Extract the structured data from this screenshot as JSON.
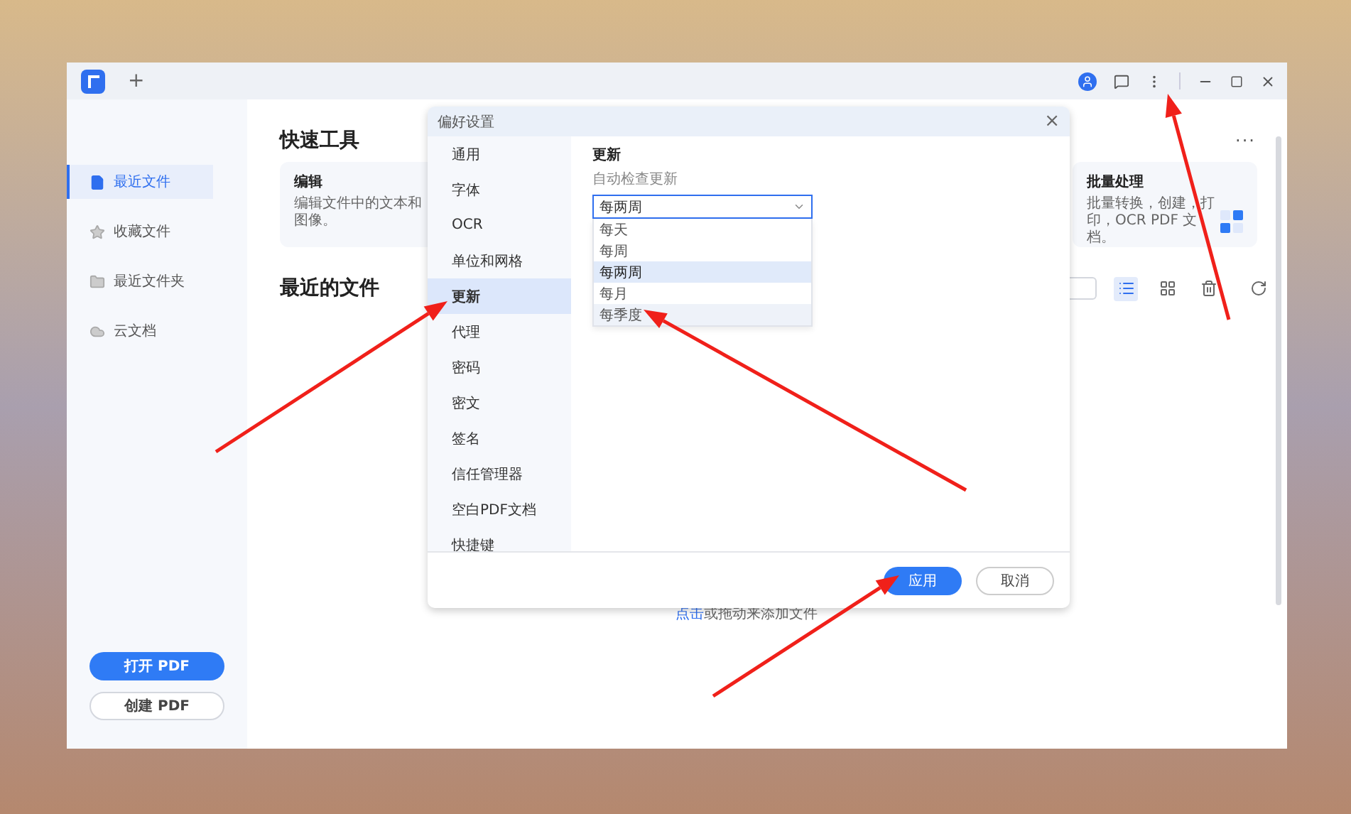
{
  "titlebar": {
    "new_tab": "+"
  },
  "sidebar": {
    "items": [
      {
        "label": "最近文件",
        "selected": true
      },
      {
        "label": "收藏文件",
        "selected": false
      },
      {
        "label": "最近文件夹",
        "selected": false
      },
      {
        "label": "云文档",
        "selected": false
      }
    ],
    "buttons": [
      {
        "label": "打开 PDF",
        "kind": "primary"
      },
      {
        "label": "创建 PDF",
        "kind": "secondary"
      }
    ]
  },
  "quick_tools": {
    "title": "快速工具",
    "more": "···",
    "cards": [
      {
        "title": "编辑",
        "description": "编辑文件中的文本和图像。"
      },
      {
        "title": "批量处理",
        "description": "批量转换，创建，打印，OCR PDF 文档。"
      }
    ]
  },
  "recent_files": {
    "title": "最近的文件",
    "views": [
      {
        "selected": true
      },
      {
        "selected": false
      }
    ],
    "drop_hint_link": "点击",
    "drop_hint": "或拖动来添加文件"
  },
  "dialog": {
    "title": "偏好设置",
    "close": "×",
    "nav": [
      {
        "label": "通用",
        "selected": false
      },
      {
        "label": "字体",
        "selected": false
      },
      {
        "label": "OCR",
        "selected": false
      },
      {
        "label": "单位和网格",
        "selected": false
      },
      {
        "label": "更新",
        "selected": true
      },
      {
        "label": "代理",
        "selected": false
      },
      {
        "label": "密码",
        "selected": false
      },
      {
        "label": "密文",
        "selected": false
      },
      {
        "label": "签名",
        "selected": false
      },
      {
        "label": "信任管理器",
        "selected": false
      },
      {
        "label": "空白PDF文档",
        "selected": false
      },
      {
        "label": "快捷键",
        "selected": false
      }
    ],
    "section_title": "更新",
    "field_label": "自动检查更新",
    "select": {
      "value": "每两周",
      "expanded": true
    },
    "options": [
      {
        "label": "每天",
        "selected": false,
        "hovered": false
      },
      {
        "label": "每周",
        "selected": false,
        "hovered": false
      },
      {
        "label": "每两周",
        "selected": true,
        "hovered": false
      },
      {
        "label": "每月",
        "selected": false,
        "hovered": false
      },
      {
        "label": "每季度",
        "selected": false,
        "hovered": true
      }
    ],
    "buttons": [
      {
        "label": "应用",
        "kind": "primary"
      },
      {
        "label": "取消",
        "kind": "secondary"
      }
    ]
  }
}
